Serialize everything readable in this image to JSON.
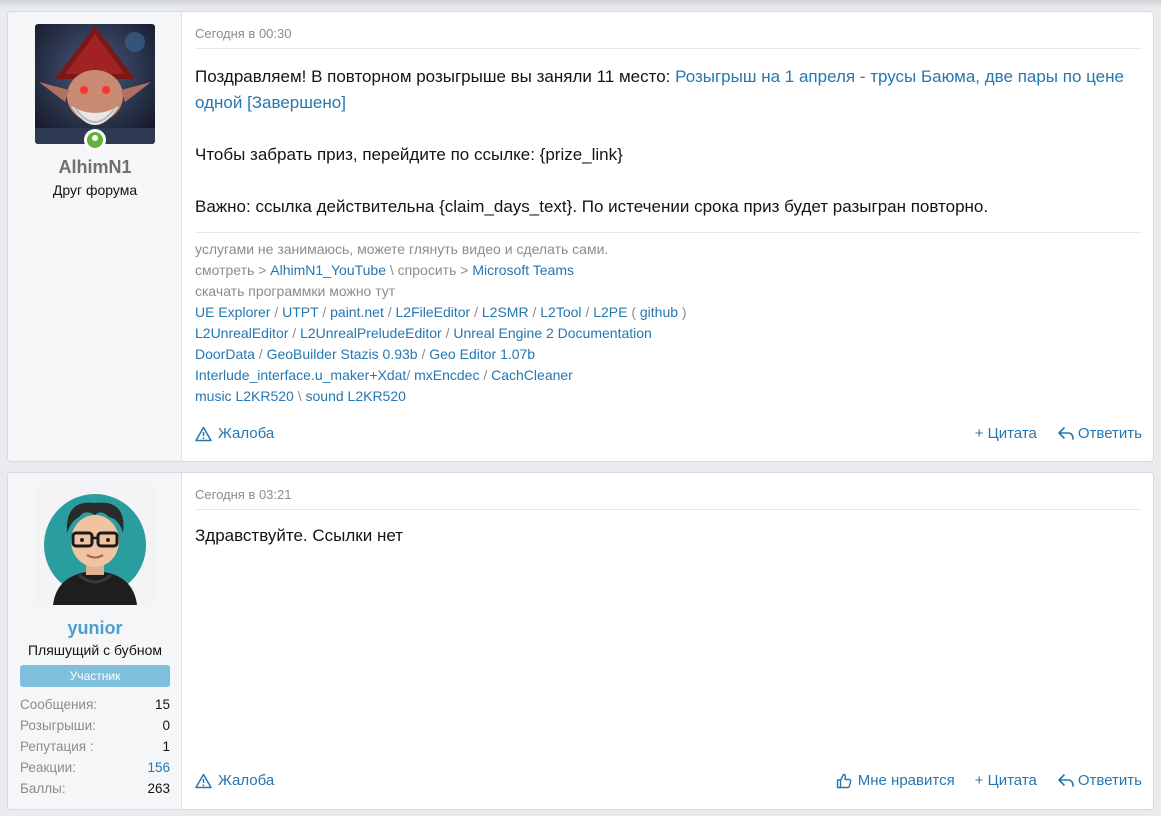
{
  "posts": [
    {
      "user": {
        "name": "AlhimN1",
        "name_color": "#6f6f6f",
        "title": "Друг форума",
        "online": true
      },
      "date": "Сегодня в 00:30",
      "message": {
        "line1_text": "Поздравляем! В повторном розыгрыше вы заняли 11 место: ",
        "line1_link": "Розыгрыш на 1 апреля - трусы Баюма, две пары по цене одной [Завершено]",
        "line2": "Чтобы забрать приз, перейдите по ссылке: {prize_link}",
        "line3": "Важно: ссылка действительна {claim_days_text}. По истечении срока приз будет разыгран повторно."
      },
      "signature": {
        "line1": "услугами не занимаюсь, можете глянуть видео и сделать сами.",
        "watch": "смотреть > ",
        "youtube": "AlhimN1_YouTube",
        "ask": " \\ спросить > ",
        "teams": "Microsoft Teams",
        "download": "скачать программки можно тут",
        "links_row1": [
          "UE Explorer",
          "UTPT",
          "paint.net",
          "L2FileEditor",
          "L2SMR",
          "L2Tool",
          "L2PE",
          "github"
        ],
        "links_row2": [
          "L2UnrealEditor",
          "L2UnrealPreludeEditor",
          "Unreal Engine 2 Documentation"
        ],
        "links_row3": [
          "DoorData",
          "GeoBuilder Stazis 0.93b",
          "Geo Editor 1.07b"
        ],
        "links_row4": [
          "Interlude_interface.u_maker+Xdat",
          "mxEncdec",
          "CachCleaner"
        ],
        "links_row5": [
          "music L2KR520",
          "sound L2KR520"
        ]
      },
      "actions": {
        "report": "Жалоба",
        "quote": "+ Цитата",
        "reply": "Ответить"
      }
    },
    {
      "user": {
        "name": "yunior",
        "name_color": "#4a9fd0",
        "title": "Пляшущий с бубном",
        "badge": "Участник",
        "stats": [
          {
            "label": "Сообщения:",
            "value": "15"
          },
          {
            "label": "Розыгрыши:",
            "value": "0"
          },
          {
            "label": "Репутация :",
            "value": "1"
          },
          {
            "label": "Реакции:",
            "value": "156"
          },
          {
            "label": "Баллы:",
            "value": "263"
          }
        ]
      },
      "date": "Сегодня в 03:21",
      "message": {
        "text": "Здравствуйте. Ссылки нет"
      },
      "actions": {
        "report": "Жалоба",
        "like": "Мне нравится",
        "quote": "+ Цитата",
        "reply": "Ответить"
      }
    }
  ],
  "colors": {
    "link": "#2577b1",
    "muted": "#8c8c8c",
    "badge": "#7fbfde",
    "online": "#63b23c"
  },
  "icons": [
    "warning-icon",
    "plus-icon",
    "reply-icon",
    "thumbs-up-icon",
    "online-indicator-icon"
  ]
}
